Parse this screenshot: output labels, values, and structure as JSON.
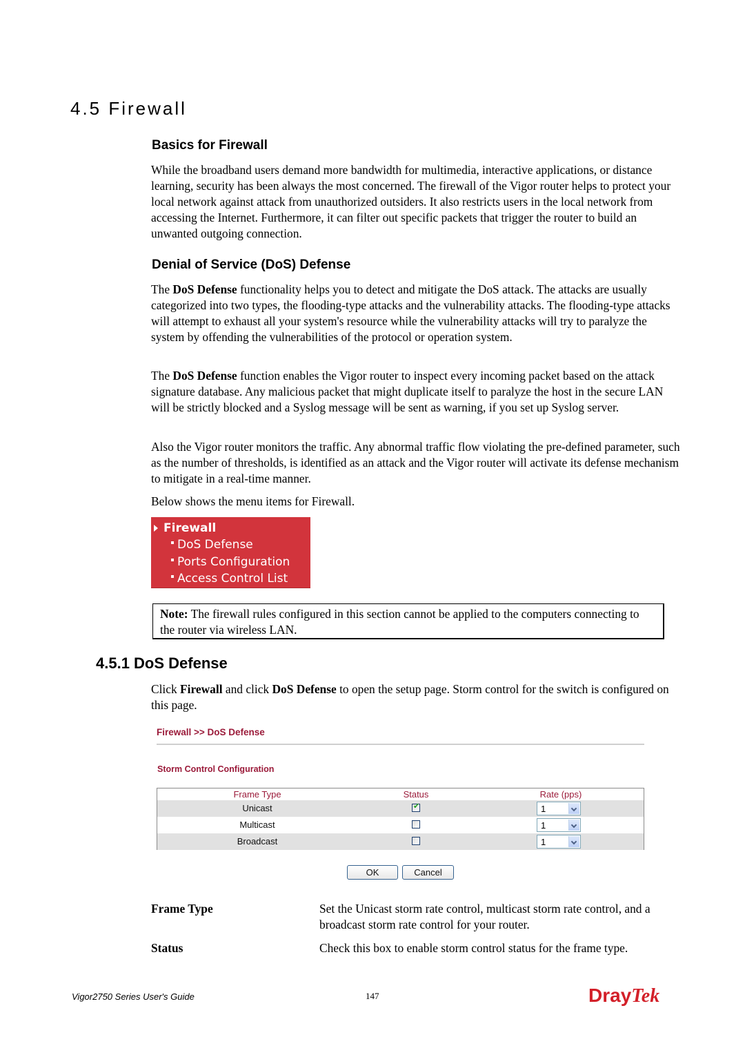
{
  "section_title": "4.5 Firewall",
  "basics": {
    "heading": "Basics for Firewall",
    "paragraph": "While the broadband users demand more bandwidth for multimedia, interactive applications, or distance learning, security has been always the most concerned. The firewall of the Vigor router helps to protect your local network against attack from unauthorized outsiders. It also restricts users in the local network from accessing the Internet. Furthermore, it can filter out specific packets that trigger the router to build an unwanted outgoing connection."
  },
  "dos": {
    "heading": "Denial of Service (DoS) Defense",
    "p1": {
      "pre": "The ",
      "bold": "DoS Defense",
      "post": " functionality helps you to detect and mitigate the DoS attack. The attacks are usually categorized into two types, the flooding-type attacks and the vulnerability attacks. The flooding-type attacks will attempt to exhaust all your system's resource while the vulnerability attacks will try to paralyze the system by offending the vulnerabilities of the protocol or operation system."
    },
    "p2": {
      "pre": "The ",
      "bold": "DoS Defense",
      "post": " function enables the Vigor router to inspect every incoming packet based on the attack signature database. Any malicious packet that might duplicate itself to paralyze the host in the secure LAN will be strictly blocked and a Syslog message will be sent as warning, if you set up Syslog server."
    },
    "p3": "Also the Vigor router monitors the traffic. Any abnormal traffic flow violating the pre-defined parameter, such as the number of thresholds, is identified as an attack and the Vigor router will activate its defense mechanism to mitigate in a real-time manner.",
    "p4": "Below shows the menu items for Firewall."
  },
  "firewall_menu": {
    "title": "Firewall",
    "items": [
      "DoS Defense",
      "Ports Configuration",
      "Access Control List"
    ],
    "bg_color": "#d2343c"
  },
  "note": {
    "label": "Note:",
    "text": " The firewall rules configured in this section cannot be applied to the computers connecting to the router via wireless LAN."
  },
  "subsection": {
    "heading": "4.5.1 DoS Defense",
    "intro": {
      "t1": "Click ",
      "b1": "Firewall",
      "t2": " and click ",
      "b2": "DoS Defense",
      "t3": " to open the setup page. Storm control for the switch is configured on this page."
    }
  },
  "router_ui": {
    "breadcrumb": "Firewall >> DoS Defense",
    "subtitle": "Storm Control Configuration",
    "accent_color": "#9b1b3a",
    "columns": [
      "Frame Type",
      "Status",
      "Rate (pps)"
    ],
    "rows": [
      {
        "frame_type": "Unicast",
        "status_checked": true,
        "rate": "1"
      },
      {
        "frame_type": "Multicast",
        "status_checked": false,
        "rate": "1"
      },
      {
        "frame_type": "Broadcast",
        "status_checked": false,
        "rate": "1"
      }
    ],
    "ok_label": "OK",
    "cancel_label": "Cancel"
  },
  "definitions": [
    {
      "term": "Frame Type",
      "desc": "Set the Unicast storm rate control, multicast storm rate control, and a broadcast storm rate control for your router."
    },
    {
      "term": "Status",
      "desc": "Check this box to enable storm control status for the frame type."
    }
  ],
  "footer": {
    "guide": "Vigor2750 Series User's Guide",
    "page": "147",
    "logo_part1": "Dray",
    "logo_part2": "Tek",
    "logo_color": "#d32029"
  }
}
